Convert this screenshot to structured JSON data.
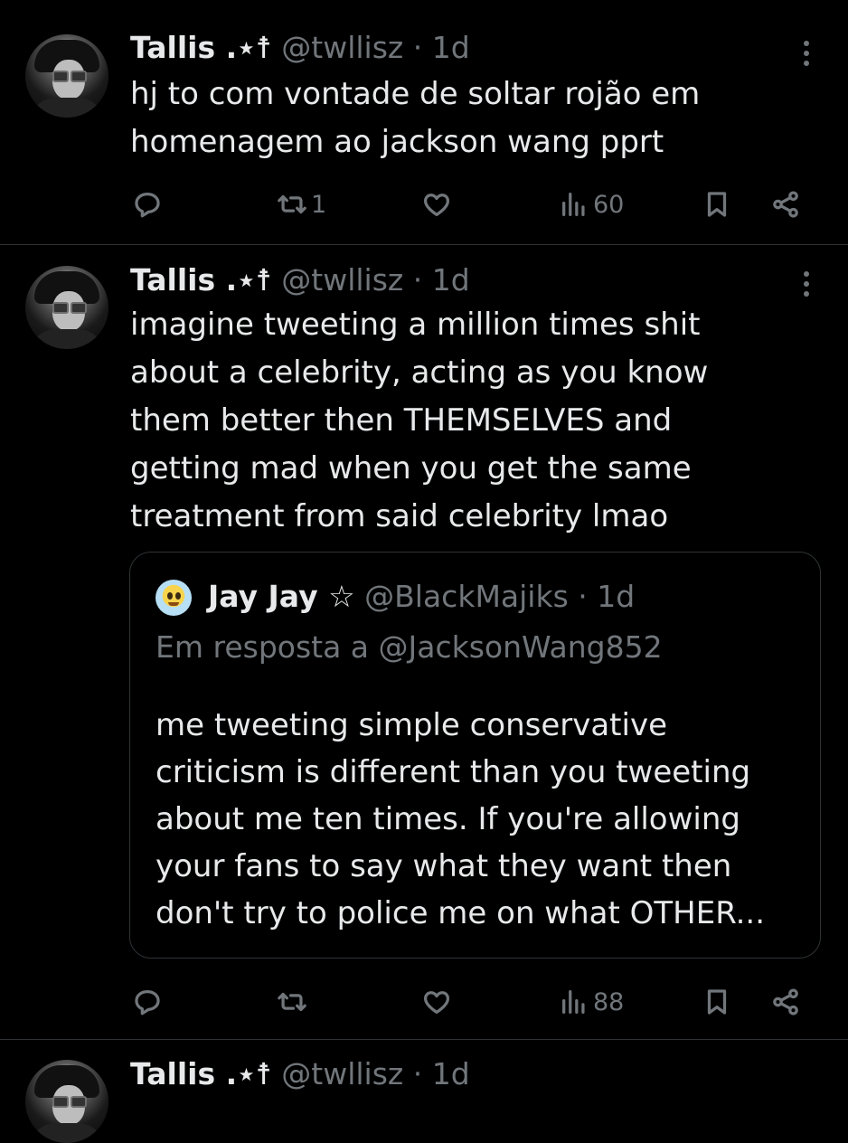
{
  "tweets": [
    {
      "name": "Tallis .⋆☨",
      "handle": "@twllisz",
      "separator": "·",
      "time": "1d",
      "lines": [
        "hj to com vontade de soltar rojão em",
        "homenagem ao jackson wang pprt"
      ],
      "retweets": "1",
      "likes": "",
      "views": "60"
    },
    {
      "name": "Tallis .⋆☨",
      "handle": "@twllisz",
      "separator": "·",
      "time": "1d",
      "lines": [
        "imagine tweeting a million times shit",
        "about a celebrity, acting as you know",
        "them better then THEMSELVES and",
        "getting mad when you get the same",
        "treatment from said celebrity lmao"
      ],
      "retweets": "",
      "likes": "",
      "views": "88",
      "quote": {
        "name": "Jay Jay ☆",
        "handle": "@BlackMajiks",
        "separator": "·",
        "time": "1d",
        "reply_to": "Em resposta a @JacksonWang852",
        "lines": [
          "me tweeting simple conservative",
          "criticism is different than you tweeting",
          "about me ten times. If you're allowing",
          "your fans to say what they want then",
          "don't try to police me on what OTHER..."
        ]
      }
    },
    {
      "name": "Tallis .⋆☨",
      "handle": "@twllisz",
      "separator": "·",
      "time": "1d"
    }
  ],
  "icons": {
    "reply": "reply-icon",
    "retweet": "retweet-icon",
    "like": "heart-icon",
    "views": "views-icon",
    "bookmark": "bookmark-icon",
    "share": "share-icon",
    "more": "more-icon"
  },
  "colors": {
    "background": "#000000",
    "text": "#e7e9ea",
    "muted": "#71767b",
    "border": "#2f3336"
  }
}
